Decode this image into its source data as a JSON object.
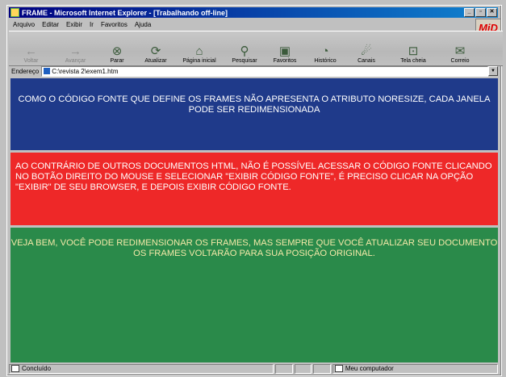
{
  "window": {
    "title": "FRAME - Microsoft Internet Explorer - [Trabalhando off-line]",
    "controls": [
      "_",
      "▫",
      "✕"
    ]
  },
  "menu": [
    "Arquivo",
    "Editar",
    "Exibir",
    "Ir",
    "Favoritos",
    "Ajuda"
  ],
  "logo": "MiD",
  "toolbar": [
    {
      "label": "Voltar",
      "icon": "back-arrow-icon",
      "glyph": "←",
      "disabled": true
    },
    {
      "label": "Avançar",
      "icon": "forward-arrow-icon",
      "glyph": "→",
      "disabled": true
    },
    {
      "label": "Parar",
      "icon": "stop-icon",
      "glyph": "⊗",
      "disabled": false
    },
    {
      "label": "Atualizar",
      "icon": "refresh-icon",
      "glyph": "⟳",
      "disabled": false
    },
    {
      "label": "Página inicial",
      "icon": "home-icon",
      "glyph": "⌂",
      "disabled": false
    },
    {
      "label": "Pesquisar",
      "icon": "search-icon",
      "glyph": "⚲",
      "disabled": false
    },
    {
      "label": "Favoritos",
      "icon": "favorites-icon",
      "glyph": "▣",
      "disabled": false
    },
    {
      "label": "Histórico",
      "icon": "history-icon",
      "glyph": "◔",
      "disabled": false
    },
    {
      "label": "Canais",
      "icon": "channels-icon",
      "glyph": "☄",
      "disabled": false
    },
    {
      "label": "Tela cheia",
      "icon": "fullscreen-icon",
      "glyph": "⊡",
      "disabled": false
    },
    {
      "label": "Correio",
      "icon": "mail-icon",
      "glyph": "✉",
      "disabled": false
    }
  ],
  "address": {
    "label": "Endereço",
    "value": "C:\\revista 2\\exem1.htm"
  },
  "frames": {
    "top": "COMO O CÓDIGO FONTE QUE DEFINE OS FRAMES NÃO APRESENTA O ATRIBUTO NORESIZE, CADA JANELA PODE SER REDIMENSIONADA",
    "middle": "AO CONTRÁRIO DE OUTROS DOCUMENTOS HTML, NÃO É POSSÍVEL ACESSAR O CÓDIGO FONTE CLICANDO NO BOTÃO DIREITO DO MOUSE E SELECIONAR \"EXIBIR CÓDIGO FONTE\", É PRECISO CLICAR NA OPÇÃO \"EXIBIR\" DE SEU BROWSER, E DEPOIS EXIBIR CÓDIGO FONTE.",
    "bottom": "VEJA BEM, VOCÊ PODE REDIMENSIONAR OS FRAMES, MAS SEMPRE QUE VOCÊ ATUALIZAR SEU DOCUMENTO OS FRAMES VOLTARÃO PARA SUA POSIÇÃO ORIGINAL.",
    "colors": {
      "top": "#1f3a8a",
      "middle": "#ee2828",
      "bottom": "#2a8a4a"
    }
  },
  "status": {
    "left": "Concluído",
    "zone": "Meu computador"
  }
}
